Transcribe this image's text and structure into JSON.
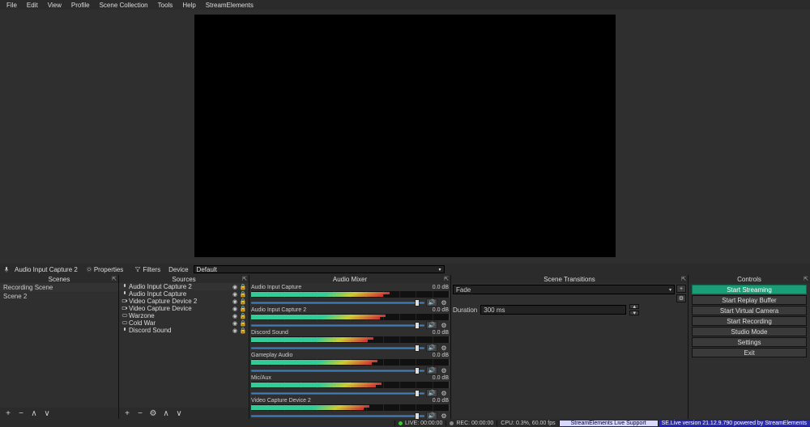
{
  "menus": [
    "File",
    "Edit",
    "View",
    "Profile",
    "Scene Collection",
    "Tools",
    "Help",
    "StreamElements"
  ],
  "context_toolbar": {
    "source_name": "Audio Input Capture 2",
    "properties_label": "Properties",
    "filters_label": "Filters",
    "device_label": "Device",
    "device_value": "Default"
  },
  "panels": {
    "scenes": {
      "title": "Scenes",
      "items": [
        "Recording Scene",
        "Scene 2"
      ]
    },
    "sources": {
      "title": "Sources",
      "items": [
        {
          "icon": "mic",
          "label": "Audio Input Capture 2",
          "selected": true
        },
        {
          "icon": "mic",
          "label": "Audio Input Capture"
        },
        {
          "icon": "cam",
          "label": "Video Capture Device 2"
        },
        {
          "icon": "cam",
          "label": "Video Capture Device"
        },
        {
          "icon": "game",
          "label": "Warzone"
        },
        {
          "icon": "game",
          "label": "Cold War"
        },
        {
          "icon": "mic",
          "label": "Discord Sound"
        }
      ]
    },
    "mixer": {
      "title": "Audio Mixer",
      "tracks": [
        {
          "name": "Audio Input Capture",
          "db": "0.0 dB",
          "fill": 70
        },
        {
          "name": "Audio Input Capture 2",
          "db": "0.0 dB",
          "fill": 68
        },
        {
          "name": "Discord Sound",
          "db": "0.0 dB",
          "fill": 62
        },
        {
          "name": "Gameplay Audio",
          "db": "0.0 dB",
          "fill": 64
        },
        {
          "name": "Mic/Aux",
          "db": "0.0 dB",
          "fill": 66
        },
        {
          "name": "Video Capture Device 2",
          "db": "0.0 dB",
          "fill": 60
        }
      ]
    },
    "transitions": {
      "title": "Scene Transitions",
      "current": "Fade",
      "duration_label": "Duration",
      "duration_value": "300 ms"
    },
    "controls": {
      "title": "Controls",
      "buttons": [
        {
          "label": "Start Streaming",
          "primary": true
        },
        {
          "label": "Start Replay Buffer"
        },
        {
          "label": "Start Virtual Camera"
        },
        {
          "label": "Start Recording"
        },
        {
          "label": "Studio Mode"
        },
        {
          "label": "Settings"
        },
        {
          "label": "Exit"
        }
      ]
    }
  },
  "status": {
    "live_label": "LIVE: 00:00:00",
    "rec_label": "REC: 00:00:00",
    "cpu_label": "CPU: 0.3%, 60.00 fps",
    "support": "StreamElements Live Support",
    "version": "SE.Live version 21.12.9.790 powered by StreamElements"
  },
  "icons": {
    "mic": "🎤",
    "cam": "📷",
    "game": "🎮",
    "gear": "⚙",
    "eye": "👁",
    "lock": "🔒",
    "plus": "+",
    "minus": "−",
    "up": "∧",
    "down": "∨"
  }
}
